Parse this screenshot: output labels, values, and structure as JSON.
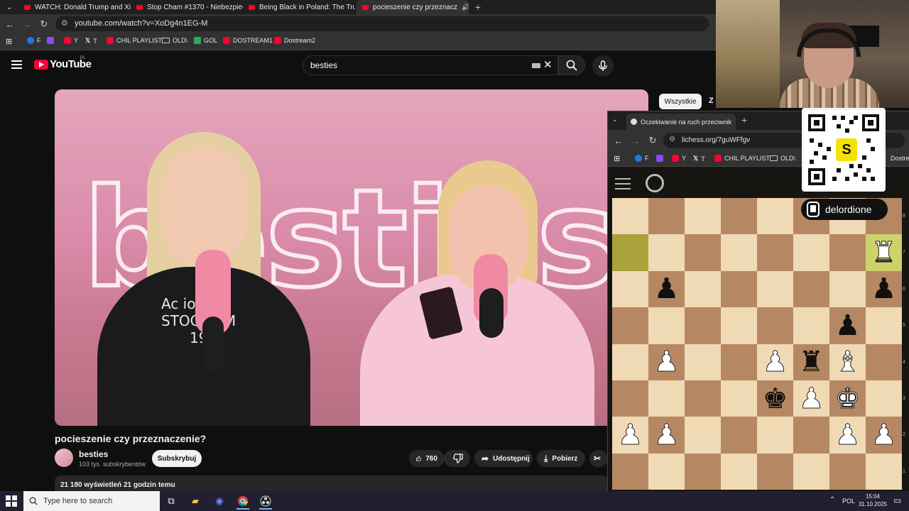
{
  "browser": {
    "tabs": [
      {
        "label": "WATCH: Donald Trump and Xi J"
      },
      {
        "label": "Stop Cham #1370 - Niebezpiec"
      },
      {
        "label": "Being Black in Poland: The Trut"
      },
      {
        "label": "pocieszenie czy przeznacz"
      }
    ],
    "url": "youtube.com/watch?v=XoDg4n1EG-M",
    "bookmarks": [
      {
        "label": "F",
        "icon": "facebook-icon"
      },
      {
        "label": "",
        "icon": "twitch-icon"
      },
      {
        "label": "Y",
        "icon": "youtube-icon"
      },
      {
        "label": "T",
        "icon": "x-icon"
      },
      {
        "label": "CHIL PLAYLIST",
        "icon": "youtube-icon"
      },
      {
        "label": "OLD\\",
        "icon": "folder-icon"
      },
      {
        "label": "GOL",
        "icon": "g-icon"
      },
      {
        "label": "DOSTREAM1",
        "icon": "youtube-icon"
      },
      {
        "label": "Dostream2",
        "icon": "youtube-icon"
      }
    ]
  },
  "youtube": {
    "logo": "YouTube",
    "region": "PL",
    "search_value": "besties",
    "video_title": "pocieszenie czy przeznaczenie?",
    "channel": {
      "name": "besties",
      "subscribers": "103 tys. subskrybentów"
    },
    "subscribe_label": "Subskrybuj",
    "likes": "760",
    "share_label": "Udostępnij",
    "download_label": "Pobierz",
    "views_line": "21 180 wyświetleń  21 godzin temu",
    "chip_all": "Wszystkie",
    "chip_next": "Z",
    "video_overlay": {
      "neon_word": "besties",
      "shirt_print_1": "Ac       ios",
      "shirt_print_2": "STOC  OLM",
      "shirt_print_3": "19  6"
    }
  },
  "lichess_window": {
    "tab_title": "Oczekiwanie na ruch przeciwnik",
    "url": "lichess.org/7guWFfgv",
    "bookmarks": [
      {
        "label": "F"
      },
      {
        "label": ""
      },
      {
        "label": "Y"
      },
      {
        "label": "T"
      },
      {
        "label": "CHIL PLAYLIST"
      },
      {
        "label": "OLD\\"
      },
      {
        "label": "Dostre"
      }
    ],
    "opponent": "delordione",
    "rank_labels": [
      "8",
      "7",
      "6",
      "5",
      "4",
      "3",
      "2",
      "1"
    ],
    "board": [
      [
        "",
        "",
        "",
        "",
        "",
        "",
        "",
        ""
      ],
      [
        "hl",
        "",
        "",
        "",
        "",
        "",
        "",
        "wR*"
      ],
      [
        "",
        "bP",
        "",
        "",
        "",
        "",
        "",
        "bP"
      ],
      [
        "",
        "",
        "",
        "",
        "",
        "",
        "bP",
        ""
      ],
      [
        "",
        "wP",
        "",
        "",
        "wP",
        "bR",
        "wB",
        ""
      ],
      [
        "",
        "",
        "",
        "",
        "bK",
        "wP",
        "wK",
        ""
      ],
      [
        "wP",
        "wP",
        "",
        "",
        "",
        "",
        "wP",
        "wP"
      ],
      [
        "",
        "",
        "",
        "",
        "",
        "",
        "",
        ""
      ]
    ]
  },
  "qr_badge": {
    "letter": "S",
    "accent": "#f6e200"
  },
  "taskbar": {
    "search_placeholder": "Type here to search",
    "lang": "POL",
    "time": "15:04",
    "date": "31.10.2025"
  }
}
